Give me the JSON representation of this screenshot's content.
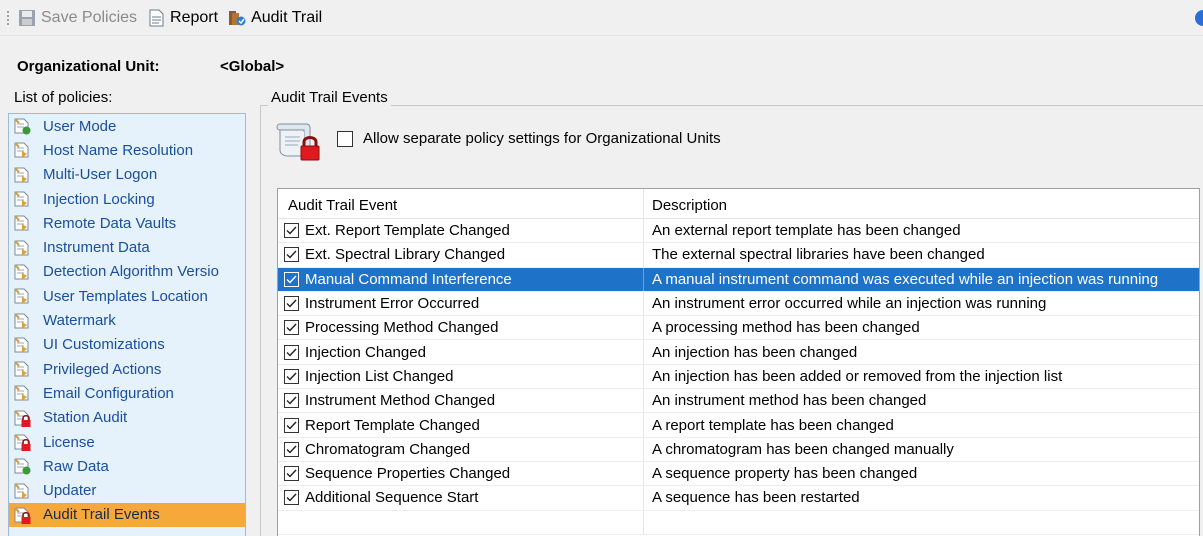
{
  "toolbar": {
    "save_label": "Save Policies",
    "report_label": "Report",
    "audit_label": "Audit Trail"
  },
  "org_unit": {
    "label": "Organizational Unit:",
    "value": "<Global>"
  },
  "policies": {
    "caption": "List of policies:",
    "items": [
      {
        "label": "User Mode",
        "icon": "policy-green-icon"
      },
      {
        "label": "Host Name Resolution",
        "icon": "policy-icon"
      },
      {
        "label": "Multi-User Logon",
        "icon": "policy-icon"
      },
      {
        "label": "Injection Locking",
        "icon": "policy-icon"
      },
      {
        "label": "Remote Data Vaults",
        "icon": "policy-icon"
      },
      {
        "label": "Instrument Data",
        "icon": "policy-icon"
      },
      {
        "label": "Detection Algorithm Versio",
        "icon": "policy-icon"
      },
      {
        "label": "User Templates Location",
        "icon": "policy-icon"
      },
      {
        "label": "Watermark",
        "icon": "policy-icon"
      },
      {
        "label": "UI Customizations",
        "icon": "policy-icon"
      },
      {
        "label": "Privileged Actions",
        "icon": "policy-icon"
      },
      {
        "label": "Email Configuration",
        "icon": "policy-icon"
      },
      {
        "label": "Station Audit",
        "icon": "policy-lock-icon"
      },
      {
        "label": "License",
        "icon": "policy-lock-icon"
      },
      {
        "label": "Raw Data",
        "icon": "policy-green-icon"
      },
      {
        "label": "Updater",
        "icon": "policy-icon"
      },
      {
        "label": "Audit Trail Events",
        "icon": "policy-lock-icon"
      }
    ],
    "selected_index": 16
  },
  "group": {
    "title": "Audit Trail Events",
    "allow_label": "Allow separate policy settings for Organizational Units",
    "allow_checked": false
  },
  "grid": {
    "col_event": "Audit Trail Event",
    "col_desc": "Description",
    "selected_index": 2,
    "rows": [
      {
        "event": "Ext. Report Template Changed",
        "desc": "An external report template has been changed",
        "checked": true
      },
      {
        "event": "Ext. Spectral Library Changed",
        "desc": "The external spectral libraries have been changed",
        "checked": true
      },
      {
        "event": "Manual Command Interference",
        "desc": "A manual instrument command was executed while an injection was running",
        "checked": true
      },
      {
        "event": "Instrument Error Occurred",
        "desc": "An instrument error occurred while an injection was running",
        "checked": true
      },
      {
        "event": "Processing Method Changed",
        "desc": "A processing method has been changed",
        "checked": true
      },
      {
        "event": "Injection Changed",
        "desc": "An injection has been changed",
        "checked": true
      },
      {
        "event": "Injection List Changed",
        "desc": "An injection has been added or removed from the injection list",
        "checked": true
      },
      {
        "event": "Instrument Method Changed",
        "desc": "An instrument method has been changed",
        "checked": true
      },
      {
        "event": "Report Template Changed",
        "desc": "A report template has been changed",
        "checked": true
      },
      {
        "event": "Chromatogram Changed",
        "desc": "A chromatogram has been changed manually",
        "checked": true
      },
      {
        "event": "Sequence Properties Changed",
        "desc": "A sequence property has been changed",
        "checked": true
      },
      {
        "event": "Additional Sequence Start",
        "desc": "A sequence has been restarted",
        "checked": true
      }
    ]
  },
  "colors": {
    "selected_row": "#1e73c8",
    "selected_policy": "#f7a83a",
    "list_bg": "#e5f1fb",
    "policy_text": "#1a4f9c"
  }
}
